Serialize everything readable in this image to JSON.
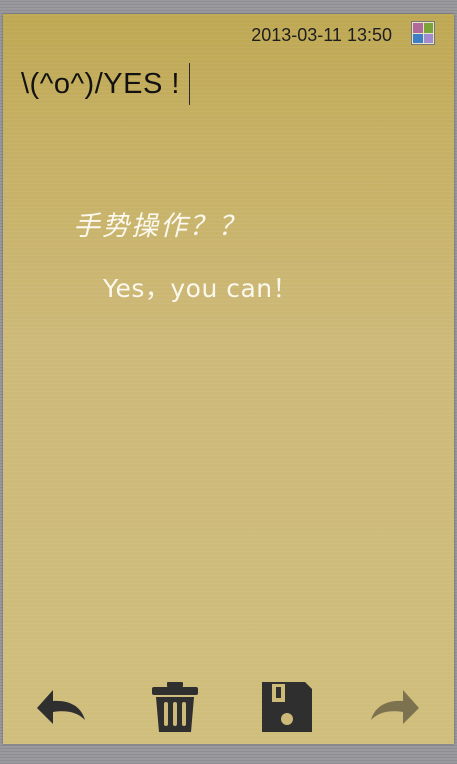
{
  "header": {
    "datetime": "2013-03-11 13:50",
    "palette_colors": [
      "#b06a9a",
      "#7aa33a",
      "#3d7fc4",
      "#a38bd0"
    ]
  },
  "note": {
    "title": "\\(^o^)/YES !",
    "body_line1": "手势操作？？",
    "body_line2": "Yes，you can！",
    "paper_color": "#cdb978",
    "text_color": "#fbf8ee"
  },
  "toolbar": {
    "icons": [
      "undo-icon",
      "trash-icon",
      "save-icon",
      "redo-icon"
    ],
    "icon_color": "#2f2f2f",
    "disabled_color": "#7d7250"
  }
}
